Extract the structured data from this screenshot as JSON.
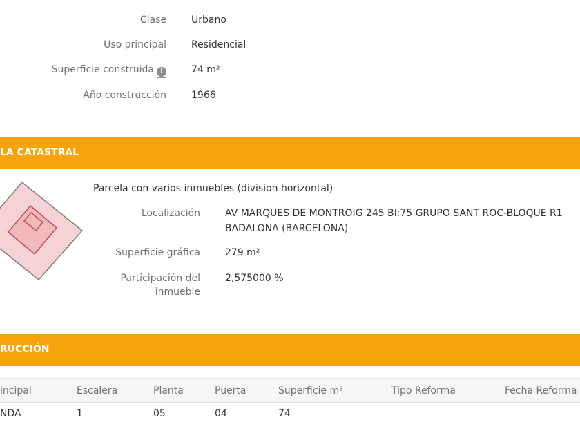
{
  "building_info": {
    "rows": [
      {
        "label": "Clase",
        "value": "Urbano"
      },
      {
        "label": "Uso principal",
        "value": "Residencial"
      },
      {
        "label": "Superficie construida",
        "value": "74 m²",
        "has_info_icon": true
      },
      {
        "label": "Año construcción",
        "value": "1966"
      }
    ]
  },
  "parcel": {
    "header": "LA CATASTRAL",
    "description": "Parcela con varios inmuebles (division horizontal)",
    "localizacion_label": "Localización",
    "localizacion_line1": "AV MARQUES DE MONTROIG 245 Bl:75 GRUPO SANT ROC-BLOQUE R1",
    "localizacion_line2": "BADALONA (BARCELONA)",
    "superficie_label": "Superficie gráfica",
    "superficie_value": "279 m²",
    "participacion_label_1": "Participación del",
    "participacion_label_2": "inmueble",
    "participacion_value": "2,575000 %"
  },
  "construction": {
    "header": "RUCCIÓN",
    "columns": [
      "incipal",
      "Escalera",
      "Planta",
      "Puerta",
      "Superficie m²",
      "Tipo Reforma",
      "Fecha Reforma"
    ],
    "rows": [
      [
        "NDA",
        "1",
        "05",
        "04",
        "74",
        "",
        ""
      ]
    ]
  },
  "colors": {
    "section_header": "#f8a30c",
    "parcel_outline": "#c04858",
    "parcel_fill": "#f5c6c9"
  },
  "icons": {
    "info": "info-circle-icon"
  }
}
